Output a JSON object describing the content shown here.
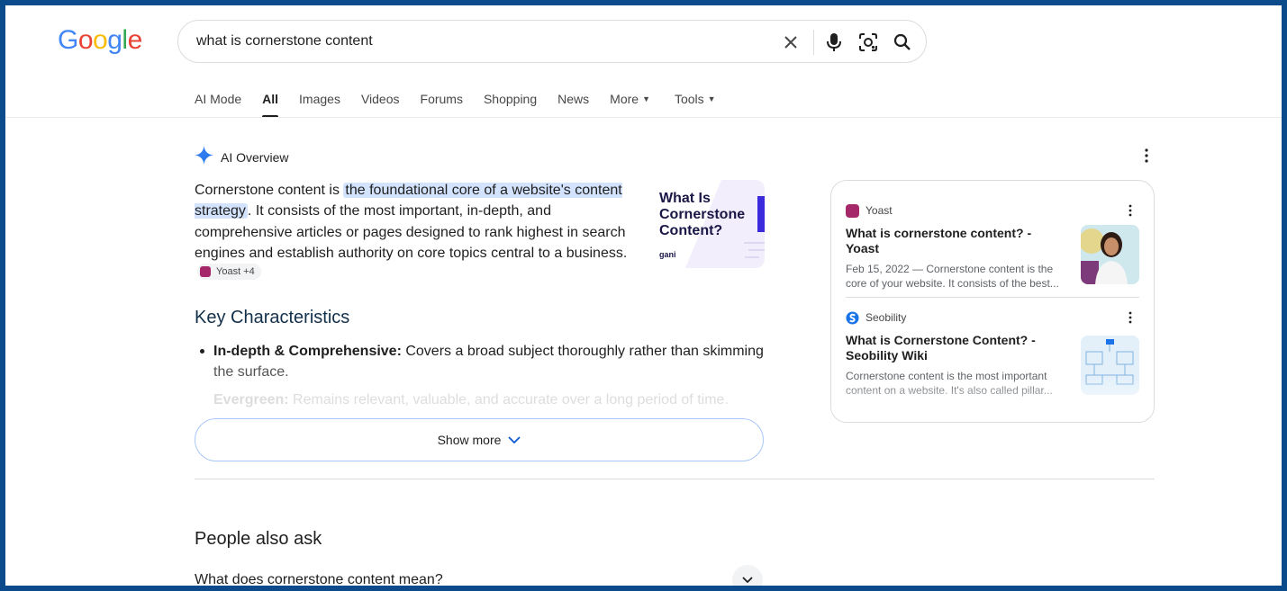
{
  "logo": {
    "letters": [
      "G",
      "o",
      "o",
      "g",
      "l",
      "e"
    ],
    "colors": [
      "#4285f4",
      "#ea4335",
      "#fbbc05",
      "#4285f4",
      "#34a853",
      "#ea4335"
    ]
  },
  "search": {
    "query": "what is cornerstone content"
  },
  "tabs": [
    {
      "label": "AI Mode"
    },
    {
      "label": "All",
      "active": true
    },
    {
      "label": "Images"
    },
    {
      "label": "Videos"
    },
    {
      "label": "Forums"
    },
    {
      "label": "Shopping"
    },
    {
      "label": "News"
    },
    {
      "label": "More",
      "dropdown": true
    },
    {
      "label": "Tools",
      "dropdown": true
    }
  ],
  "ai_overview": {
    "title": "AI Overview",
    "para_start": "Cornerstone content is ",
    "para_highlight": "the foundational core of a website's content strategy",
    "para_rest": ". It consists of the most important, in-depth, and comprehensive articles or pages designed to rank highest in search engines and establish authority on core topics central to a business.",
    "chip_label": "Yoast +4",
    "thumbnail_text": "What Is Cornerstone Content?",
    "thumbnail_brand": "gani",
    "key_heading": "Key Characteristics",
    "bullet1_bold": "In-depth & Comprehensive:",
    "bullet1_text": " Covers a broad subject thoroughly rather than skimming",
    "bullet1_text2": "the surface.",
    "bullet2_bold": "Evergreen:",
    "bullet2_text": " Remains relevant, valuable, and accurate over a long period of time.",
    "show_more": "Show more"
  },
  "sources": [
    {
      "site": "Yoast",
      "title": "What is cornerstone content? - Yoast",
      "snippet": "Feb 15, 2022 — Cornerstone content is the core of your website. It consists of the best...",
      "favicon_color": "#a4286a"
    },
    {
      "site": "Seobility",
      "title": "What is Cornerstone Content? - Seobility Wiki",
      "snippet": "Cornerstone content is the most important content on a website. It's also called pillar...",
      "favicon_color": "#1a73e8"
    }
  ],
  "people_also_ask": {
    "title": "People also ask",
    "questions": [
      "What does cornerstone content mean?"
    ]
  }
}
